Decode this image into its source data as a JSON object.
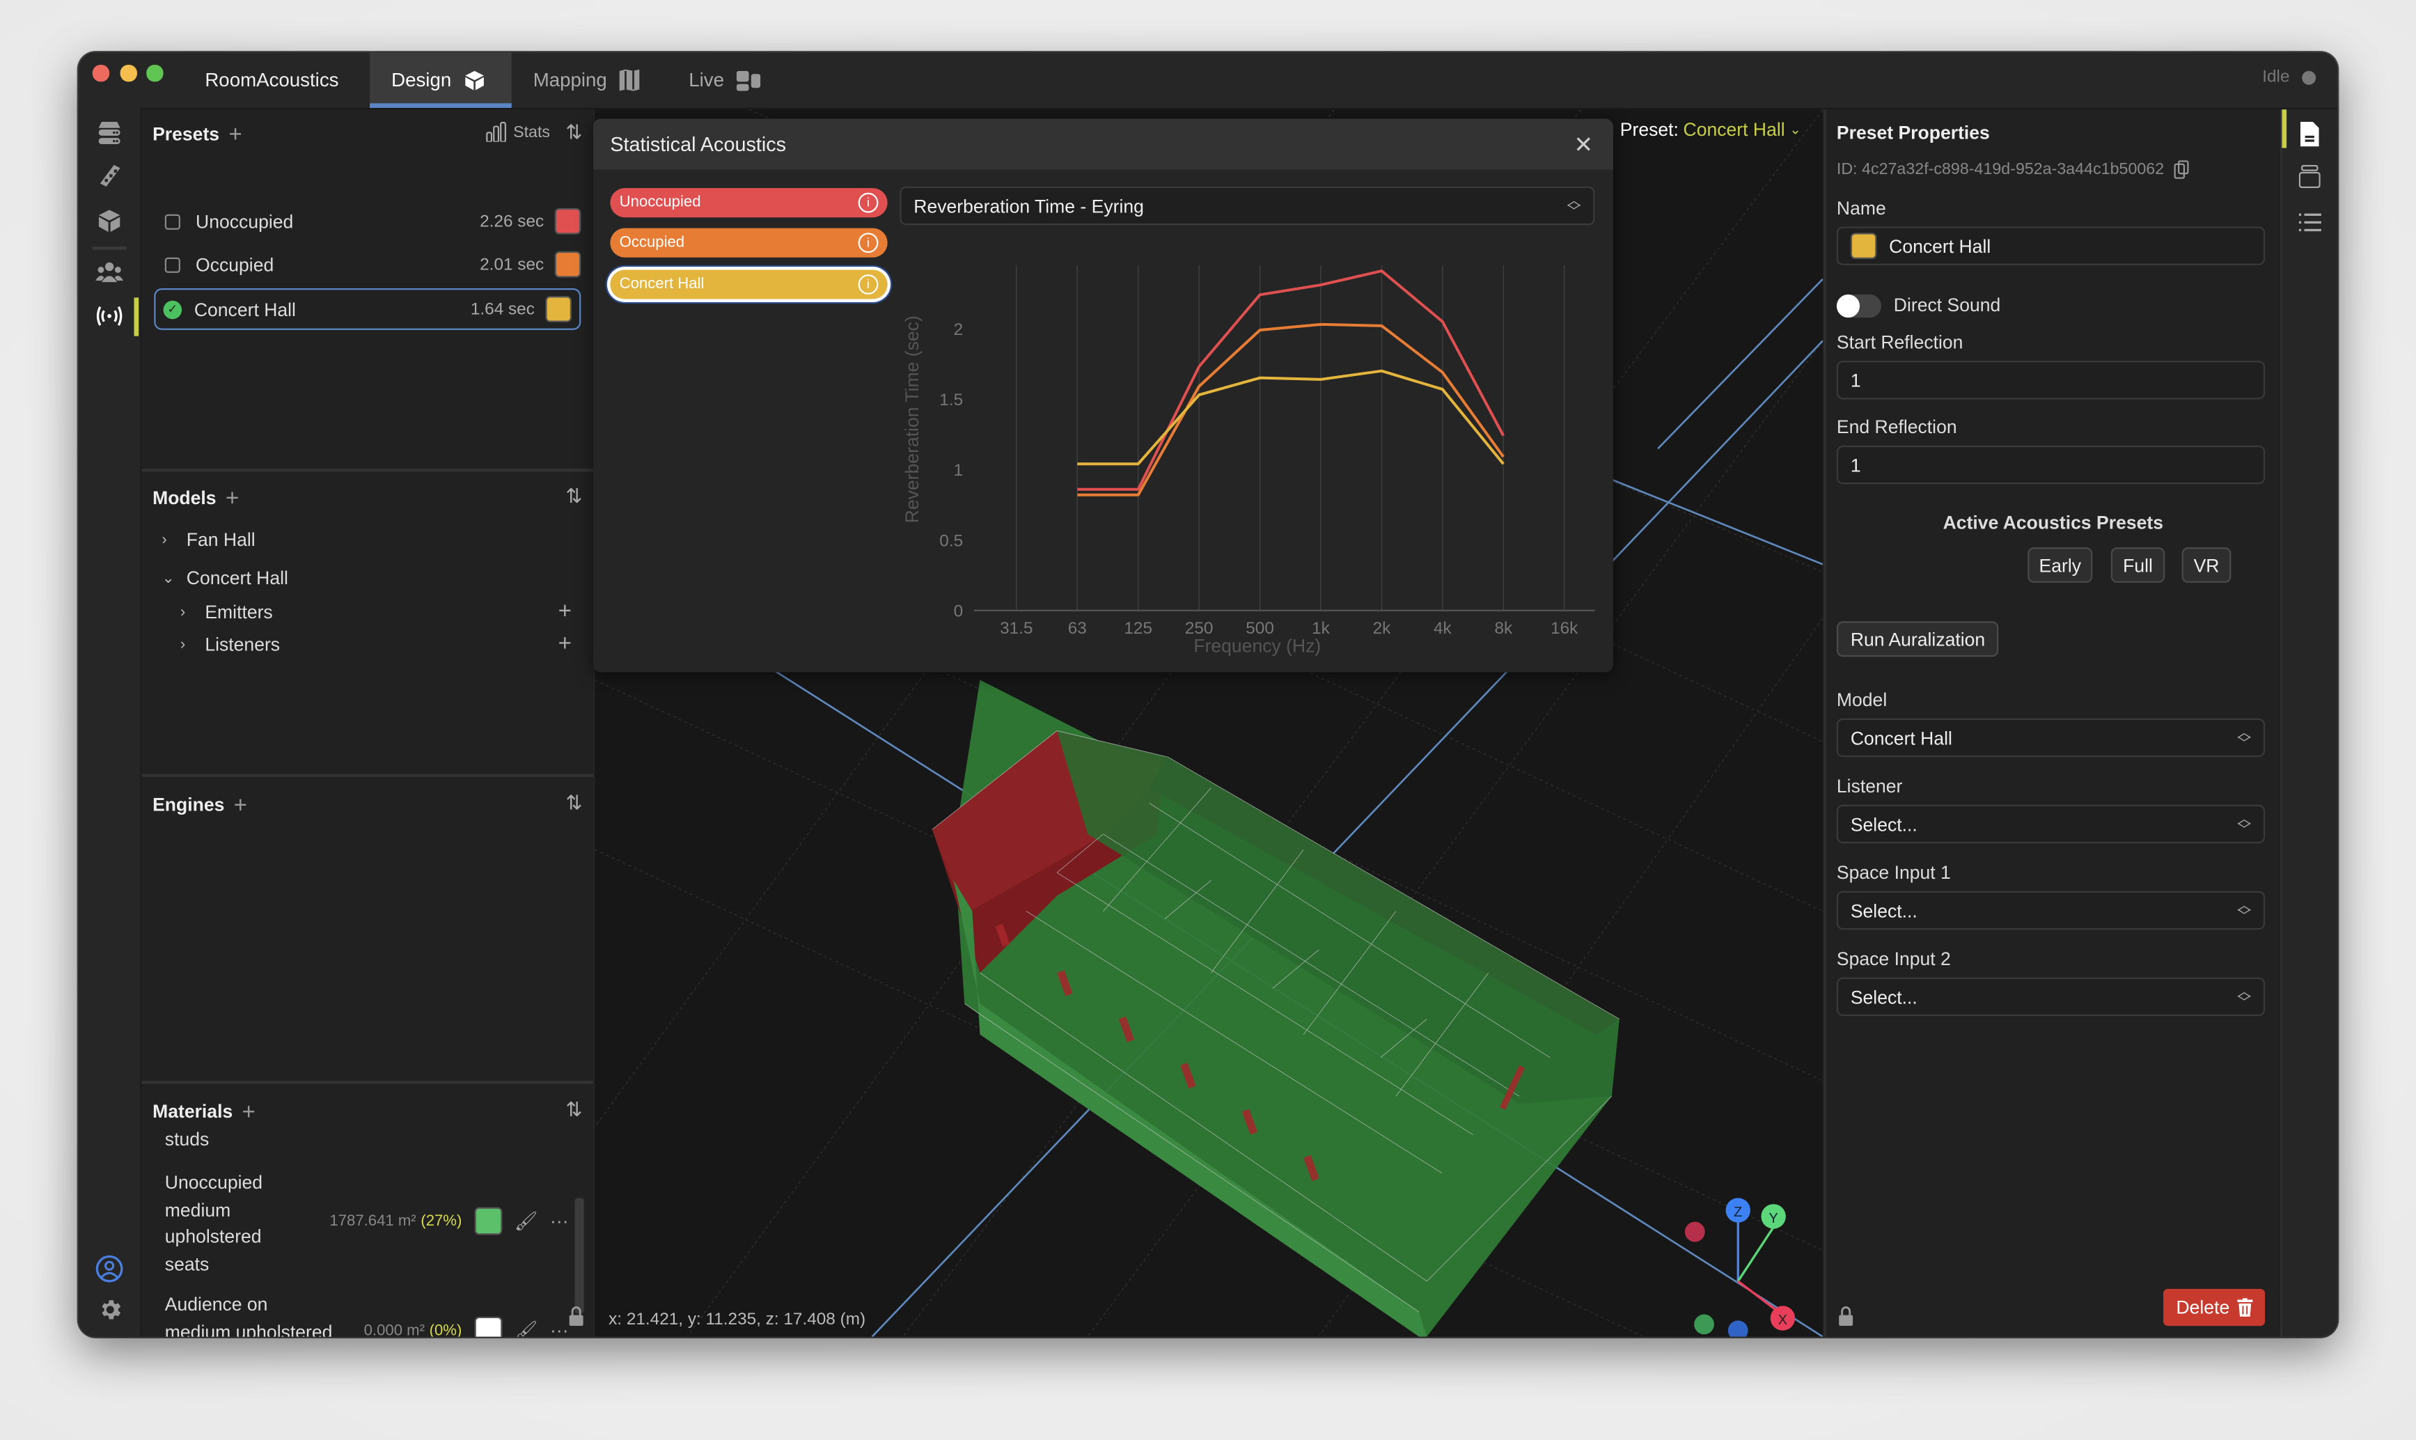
{
  "window": {
    "app_title": "RoomAcoustics",
    "tabs": [
      {
        "label": "Design",
        "icon": "cube-icon",
        "active": true
      },
      {
        "label": "Mapping",
        "icon": "map-icon",
        "active": false
      },
      {
        "label": "Live",
        "icon": "dashboard-icon",
        "active": false
      }
    ],
    "status": "Idle"
  },
  "icon_rail": [
    "database-icon",
    "swatch-fan-icon",
    "cube-icon",
    "people-icon",
    "broadcast-icon",
    "user-circle-icon",
    "gear-icon"
  ],
  "presets": {
    "title": "Presets",
    "stats_label": "Stats",
    "items": [
      {
        "name": "Unoccupied",
        "value": "2.26 sec",
        "color": "#e05050",
        "selected": false
      },
      {
        "name": "Occupied",
        "value": "2.01 sec",
        "color": "#e77d35",
        "selected": false
      },
      {
        "name": "Concert Hall",
        "value": "1.64 sec",
        "color": "#e3b53c",
        "selected": true
      }
    ]
  },
  "models": {
    "title": "Models",
    "items": [
      {
        "name": "Fan Hall",
        "expanded": false
      },
      {
        "name": "Concert Hall",
        "expanded": true,
        "children": [
          "Emitters",
          "Listeners"
        ]
      }
    ]
  },
  "engines": {
    "title": "Engines"
  },
  "materials": {
    "title": "Materials",
    "items": [
      {
        "name": "studs"
      },
      {
        "name": "Unoccupied medium upholstered seats",
        "area": "1787.641 m²",
        "pct": "(27%)",
        "color": "#5cbf6a"
      },
      {
        "name": "Audience on medium upholstered seats",
        "area": "0.000 m²",
        "pct": "(0%)",
        "color": "#ffffff"
      }
    ]
  },
  "viewport": {
    "preset_label": "Preset:",
    "preset_value": "Concert Hall",
    "coordinates": "x: 21.421, y: 11.235, z: 17.408 (m)",
    "gizmo_axes": [
      "Z",
      "Y",
      "X"
    ]
  },
  "dialog": {
    "title": "Statistical Acoustics",
    "metric_select": "Reverberation Time - Eyring",
    "legend": [
      {
        "label": "Unoccupied",
        "color": "#e05050",
        "selected": false
      },
      {
        "label": "Occupied",
        "color": "#e77d35",
        "selected": false
      },
      {
        "label": "Concert Hall",
        "color": "#e3b53c",
        "selected": true
      }
    ]
  },
  "chart_data": {
    "type": "line",
    "title": "Reverberation Time - Eyring",
    "xlabel": "Frequency (Hz)",
    "ylabel": "Reverberation Time (sec)",
    "categories": [
      "31.5",
      "63",
      "125",
      "250",
      "500",
      "1k",
      "2k",
      "4k",
      "8k",
      "16k"
    ],
    "ylim": [
      0,
      2.45
    ],
    "yticks": [
      0,
      0.5,
      1,
      1.5,
      2
    ],
    "ytick_labels": [
      "0",
      "0.5",
      "1",
      "1.5",
      "2"
    ],
    "grid": "vertical",
    "series": [
      {
        "name": "Unoccupied",
        "color": "#e05050",
        "values": [
          null,
          0.86,
          0.86,
          1.73,
          2.24,
          2.31,
          2.41,
          2.05,
          1.24,
          null
        ]
      },
      {
        "name": "Occupied",
        "color": "#e77d35",
        "values": [
          null,
          0.82,
          0.82,
          1.59,
          1.99,
          2.03,
          2.02,
          1.69,
          1.09,
          null
        ]
      },
      {
        "name": "Concert Hall",
        "color": "#e3b53c",
        "values": [
          null,
          1.04,
          1.04,
          1.53,
          1.65,
          1.64,
          1.7,
          1.57,
          1.04,
          null
        ]
      }
    ]
  },
  "properties": {
    "title": "Preset Properties",
    "id_text": "ID: 4c27a32f-c898-419d-952a-3a44c1b50062",
    "name_label": "Name",
    "name_value": "Concert Hall",
    "name_color": "#e3b53c",
    "direct_sound_label": "Direct Sound",
    "direct_sound_on": false,
    "start_reflection_label": "Start Reflection",
    "start_reflection_value": "1",
    "end_reflection_label": "End Reflection",
    "end_reflection_value": "1",
    "active_presets_title": "Active Acoustics Presets",
    "active_presets": [
      "Early",
      "Full",
      "VR"
    ],
    "run_button": "Run Auralization",
    "model_label": "Model",
    "model_value": "Concert Hall",
    "listener_label": "Listener",
    "listener_value": "Select...",
    "space_input1_label": "Space Input 1",
    "space_input1_value": "Select...",
    "space_input2_label": "Space Input 2",
    "space_input2_value": "Select...",
    "delete_button": "Delete"
  },
  "right_rail": [
    "document-icon",
    "layers-icon",
    "list-icon"
  ]
}
